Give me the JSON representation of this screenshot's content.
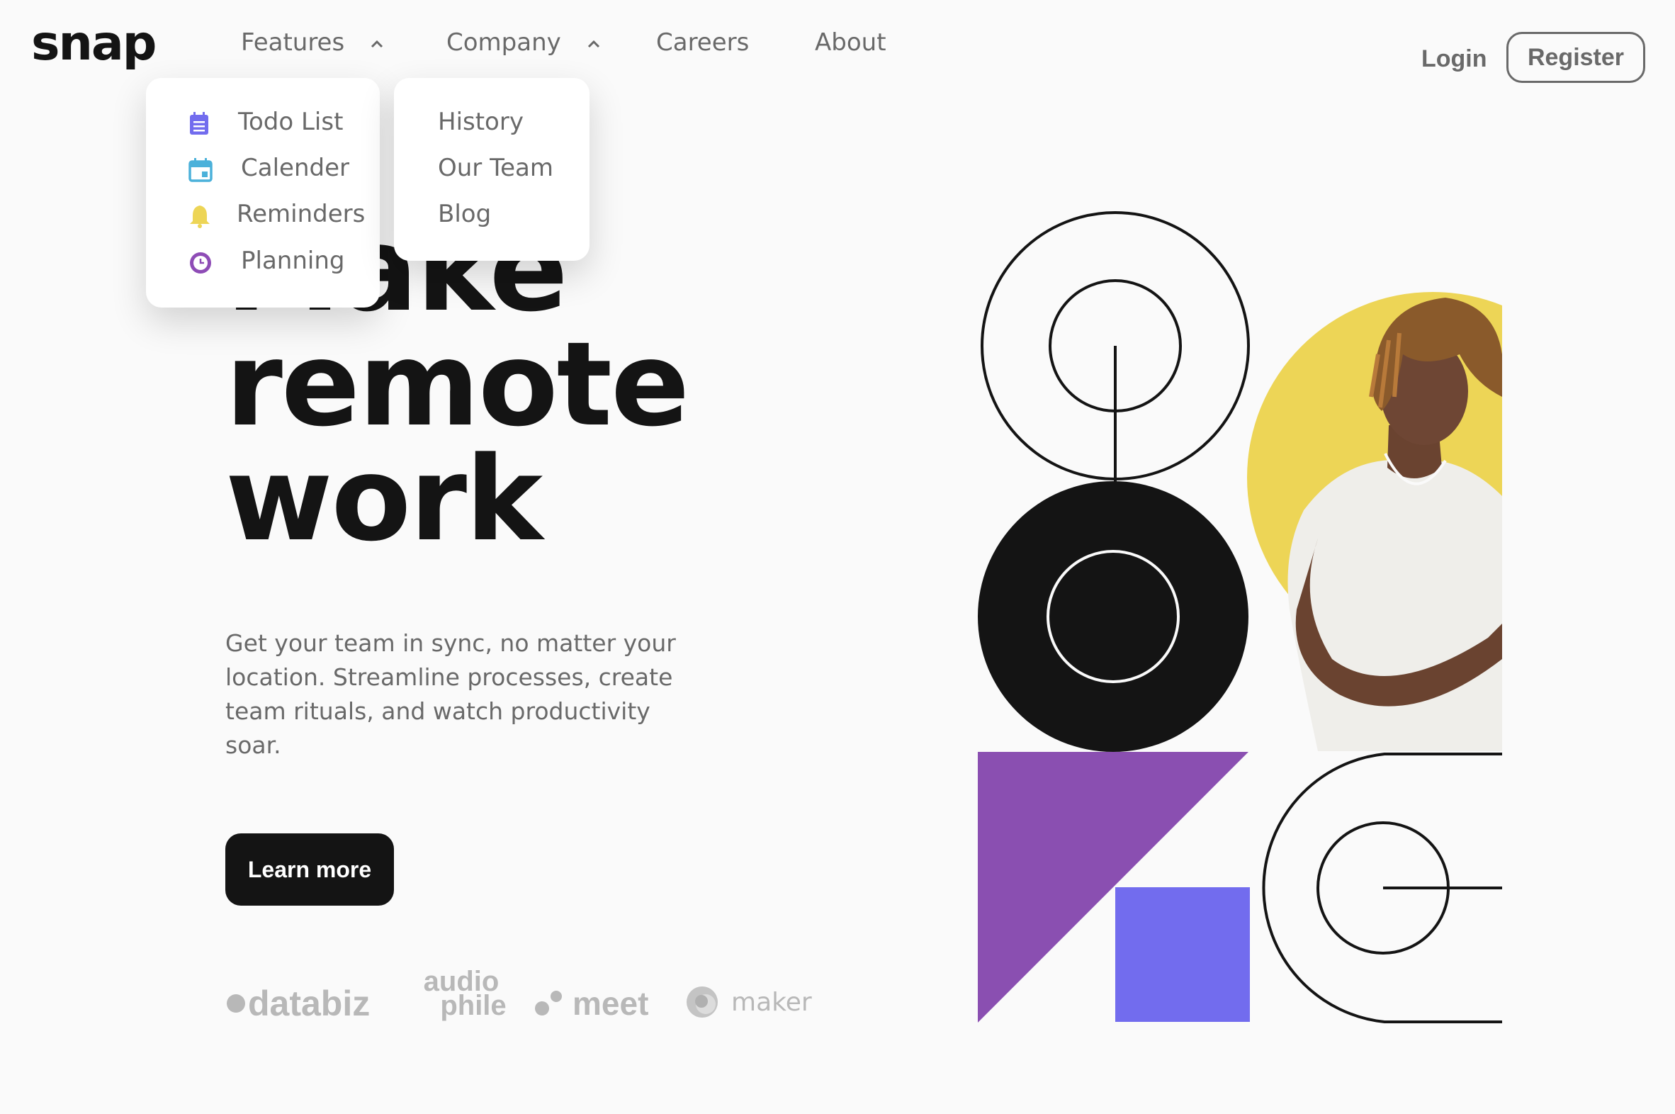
{
  "header": {
    "logo": "snap",
    "nav": [
      {
        "label": "Features",
        "has_dropdown": true,
        "expanded": true
      },
      {
        "label": "Company",
        "has_dropdown": true,
        "expanded": true
      },
      {
        "label": "Careers",
        "has_dropdown": false
      },
      {
        "label": "About",
        "has_dropdown": false
      }
    ],
    "login_label": "Login",
    "register_label": "Register"
  },
  "features_menu": [
    {
      "label": "Todo List",
      "icon": "todo-icon",
      "color": "#726CEE"
    },
    {
      "label": "Calender",
      "icon": "calendar-icon",
      "color": "#4BB1DA"
    },
    {
      "label": "Reminders",
      "icon": "bell-icon",
      "color": "#EDD556"
    },
    {
      "label": "Planning",
      "icon": "clock-icon",
      "color": "#8E4CB6"
    }
  ],
  "company_menu": [
    {
      "label": "History"
    },
    {
      "label": "Our Team"
    },
    {
      "label": "Blog"
    }
  ],
  "hero": {
    "title_line_1": "Make",
    "title_line_2": "remote",
    "title_line_3": "work",
    "description": "Get your team in sync, no matter your location. Streamline processes, create team rituals, and watch productivity soar.",
    "cta_label": "Learn more"
  },
  "clients": [
    {
      "name": "databiz"
    },
    {
      "name_line_1": "audio",
      "name_line_2": "phile"
    },
    {
      "name": "meet"
    },
    {
      "name": "maker"
    }
  ],
  "colors": {
    "text_dark": "#141414",
    "text_gray": "#696969",
    "background": "#FAFAFA",
    "accent_purple": "#8A4FB1",
    "accent_blue": "#726CEE",
    "accent_yellow": "#EDD556"
  }
}
